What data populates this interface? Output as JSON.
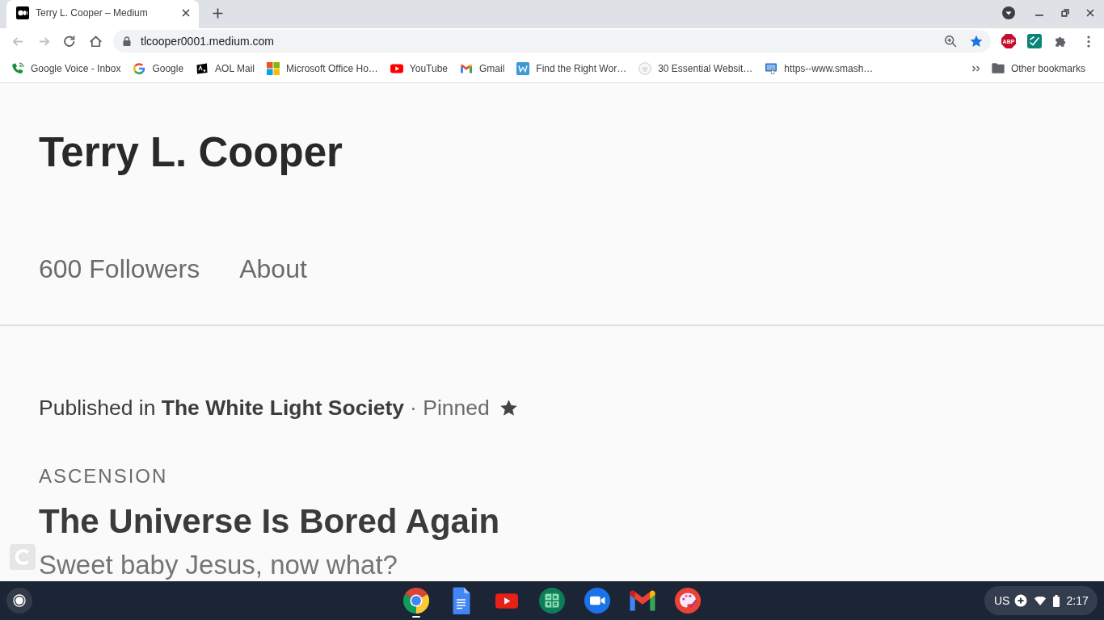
{
  "browser": {
    "tabs": [
      {
        "title": "Terry L. Cooper – Medium",
        "selected": true
      }
    ],
    "back_enabled": false,
    "forward_enabled": false,
    "address": "tlcooper0001.medium.com",
    "bookmarked": true,
    "extensions": [
      {
        "kind": "abp",
        "label": "ABP"
      },
      {
        "kind": "tile"
      },
      {
        "kind": "puzzle"
      }
    ],
    "bookmarks": [
      {
        "kind": "phone",
        "label": "Google Voice - Inbox"
      },
      {
        "kind": "google",
        "label": "Google"
      },
      {
        "kind": "aol",
        "label": "AOL Mail"
      },
      {
        "kind": "windows",
        "label": "Microsoft Office Ho…"
      },
      {
        "kind": "youtube",
        "label": "YouTube"
      },
      {
        "kind": "gmail",
        "label": "Gmail"
      },
      {
        "kind": "w",
        "label": "Find the Right Wor…"
      },
      {
        "kind": "circle",
        "label": "30 Essential Websit…"
      },
      {
        "kind": "monitor",
        "label": "https--www.smash…"
      }
    ],
    "other_bookmarks": "Other bookmarks"
  },
  "page": {
    "author": "Terry L. Cooper",
    "nav": [
      "600 Followers",
      "About"
    ],
    "post": {
      "published": "Published in **The White Light Society**",
      "pinned": "· Pinned",
      "section": "ASCENSION",
      "title": "The Universe Is Bored Again",
      "subtitle": "Sweet baby Jesus, now what?"
    }
  },
  "shelf": {
    "apps": [
      {
        "kind": "chrome",
        "active": true
      },
      {
        "kind": "docs",
        "active": false
      },
      {
        "kind": "youtube",
        "active": false
      },
      {
        "kind": "calculator",
        "active": false
      },
      {
        "kind": "camera",
        "active": false
      },
      {
        "kind": "gmail",
        "active": false
      },
      {
        "kind": "palette",
        "active": false
      }
    ],
    "keyboard": "US",
    "time": "2:17"
  }
}
